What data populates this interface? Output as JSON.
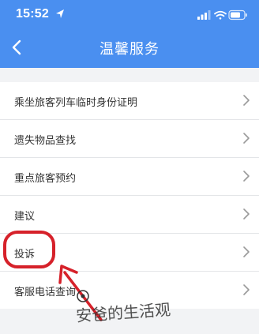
{
  "status_bar": {
    "time": "15:52"
  },
  "header": {
    "title": "温馨服务"
  },
  "menu": {
    "items": [
      {
        "label": "乘坐旅客列车临时身份证明"
      },
      {
        "label": "遗失物品查找"
      },
      {
        "label": "重点旅客预约"
      },
      {
        "label": "建议"
      },
      {
        "label": "投诉"
      },
      {
        "label": "客服电话查询"
      }
    ]
  },
  "watermark": {
    "text": "安爸的生活观"
  },
  "colors": {
    "header_bg": "#4a8ff0",
    "highlight_red": "#d6212a"
  }
}
